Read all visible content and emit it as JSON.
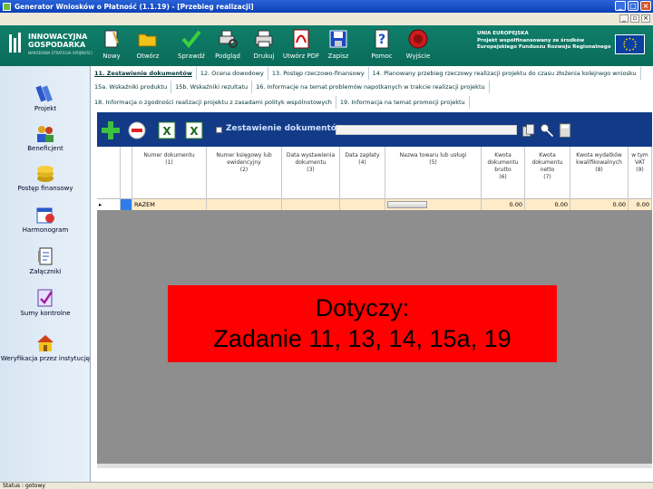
{
  "window": {
    "title": "Generator Wniosków o Płatność (1.1.19) - [Przebieg realizacji]"
  },
  "header": {
    "logo_line1": "INNOWACYJNA",
    "logo_line2": "GOSPODARKA",
    "logo_subtitle": "NARODOWA STRATEGIA SPÓJNOŚCI",
    "toolbar": [
      {
        "label": "Nowy",
        "icon": "new-document-icon"
      },
      {
        "label": "Otwórz",
        "icon": "open-folder-icon"
      },
      {
        "label": "Sprawdź",
        "icon": "checkmark-icon"
      },
      {
        "label": "Podgląd",
        "icon": "print-preview-icon"
      },
      {
        "label": "Drukuj",
        "icon": "printer-icon"
      },
      {
        "label": "Utwórz PDF",
        "icon": "pdf-icon"
      },
      {
        "label": "Zapisz",
        "icon": "save-disk-icon"
      },
      {
        "label": "Pomoc",
        "icon": "help-icon"
      },
      {
        "label": "Wyjście",
        "icon": "exit-icon"
      }
    ],
    "eu_line1": "UNIA EUROPEJSKA",
    "eu_line2": "Projekt współfinansowany ze środków",
    "eu_line3": "Europejskiego Funduszu Rozwoju Regionalnego"
  },
  "sidebar": {
    "items": [
      {
        "label": "Projekt",
        "icon": "project-books-icon"
      },
      {
        "label": "Beneficjent",
        "icon": "beneficiary-people-icon"
      },
      {
        "label": "Postęp finansowy",
        "icon": "coins-stack-icon"
      },
      {
        "label": "Harmonogram",
        "icon": "schedule-clock-icon"
      },
      {
        "label": "Załączniki",
        "icon": "attachments-icon"
      },
      {
        "label": "Sumy kontrolne",
        "icon": "checksum-icon"
      },
      {
        "label": "Weryfikacja przez instytucję",
        "icon": "institution-house-icon"
      }
    ]
  },
  "tabs": {
    "row1": [
      "11. Zestawienie dokumentów",
      "12. Ocena dowodowy",
      "13. Postęp rzeczowo-finansowy",
      "14. Planowany przebieg rzeczowy realizacji projektu do czasu złożenia kolejnego wniosku"
    ],
    "row2": [
      "15a. Wskaźniki produktu",
      "15b. Wskaźniki rezultatu",
      "16. Informacje na temat problemów napotkanych w trakcie realizacji projektu"
    ],
    "row3": [
      "18. Informacja o zgodności realizacji projektu z zasadami polityk wspólnotowych",
      "19. Informacja na temat promocji projektu"
    ],
    "active": 0
  },
  "panel": {
    "title": "Zestawienie dokumentów",
    "tools": [
      "add-plus-icon",
      "remove-minus-icon",
      "excel-import-icon",
      "excel-export-icon"
    ],
    "right_tools": [
      "copy-docs-icon",
      "filter-key-icon",
      "calculator-icon"
    ]
  },
  "table": {
    "columns": [
      {
        "label": "Numer dokumentu",
        "num": "(1)"
      },
      {
        "label": "Numer księgowy lub ewidencyjny",
        "num": "(2)"
      },
      {
        "label": "Data wystawienia dokumentu",
        "num": "(3)"
      },
      {
        "label": "Data zapłaty",
        "num": "(4)"
      },
      {
        "label": "Nazwa towaru lub usługi",
        "num": "(5)"
      },
      {
        "label": "Kwota dokumentu brutto",
        "num": "(6)"
      },
      {
        "label": "Kwota dokumentu netto",
        "num": "(7)"
      },
      {
        "label": "Kwota wydatków kwalifikowalnych",
        "num": "(8)"
      },
      {
        "label": "w tym VAT",
        "num": "(9)"
      }
    ],
    "rows": [
      {
        "marker": "▸",
        "name": "RAZEM",
        "amount6": "0.00",
        "amount7": "0.00",
        "amount8": "0.00",
        "amount9": "0.00"
      }
    ]
  },
  "overlay": {
    "line1": "Dotyczy:",
    "line2": "Zadanie 11, 13, 14, 15a, 19"
  },
  "status": {
    "text": "Status : gotowy"
  }
}
